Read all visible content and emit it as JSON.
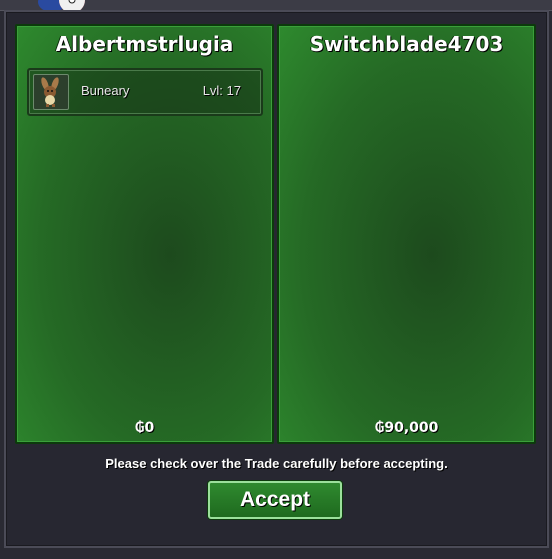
{
  "trade": {
    "left": {
      "player_name": "Albertmstrlugia",
      "pokemon": [
        {
          "name": "Buneary",
          "level": "Lvl: 17",
          "icon": "buneary-sprite-icon"
        }
      ],
      "money": "₲0"
    },
    "right": {
      "player_name": "Switchblade4703",
      "pokemon": [],
      "money": "₲90,000"
    },
    "notice": "Please check over the Trade carefully before accepting.",
    "accept_label": "Accept"
  },
  "colors": {
    "panel_green": "#256a25",
    "panel_border": "#0c3a0c",
    "button_border": "#9be09b",
    "window_bg": "#272731"
  }
}
